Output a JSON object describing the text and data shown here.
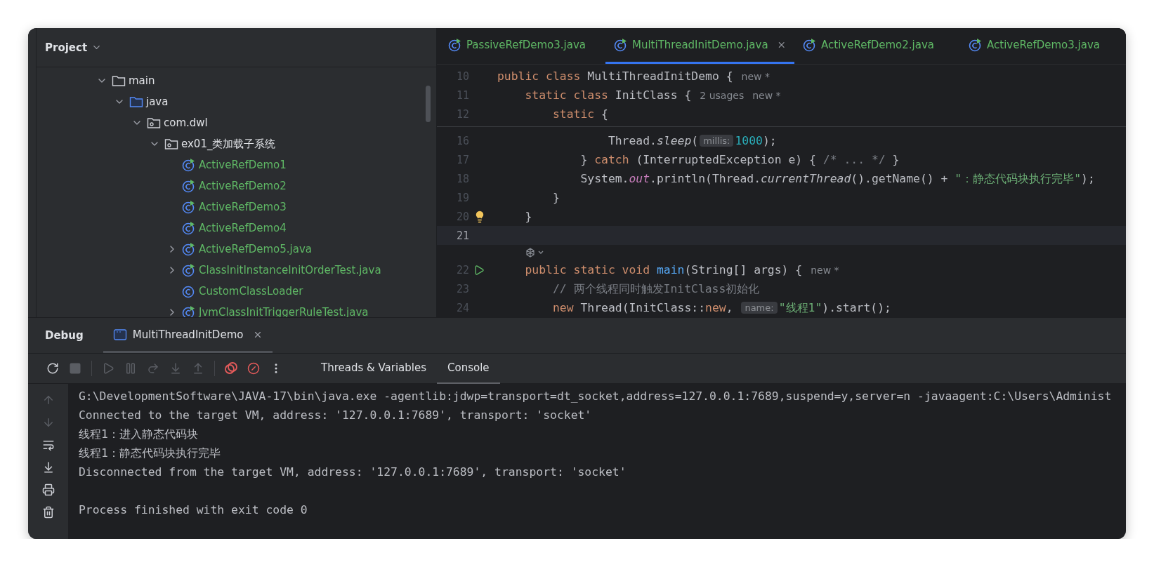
{
  "project_panel": {
    "title": "Project",
    "tree": [
      {
        "label": "main",
        "kind": "folder",
        "expanded": true,
        "children": [
          {
            "label": "java",
            "kind": "source-folder",
            "expanded": true,
            "children": [
              {
                "label": "com.dwl",
                "kind": "package",
                "expanded": true,
                "children": [
                  {
                    "label": "ex01_类加载子系统",
                    "kind": "package",
                    "expanded": true,
                    "children": [
                      {
                        "label": "ActiveRefDemo1",
                        "kind": "runnable-class"
                      },
                      {
                        "label": "ActiveRefDemo2",
                        "kind": "runnable-class"
                      },
                      {
                        "label": "ActiveRefDemo3",
                        "kind": "runnable-class"
                      },
                      {
                        "label": "ActiveRefDemo4",
                        "kind": "runnable-class"
                      },
                      {
                        "label": "ActiveRefDemo5.java",
                        "kind": "runnable-class",
                        "expanded": false
                      },
                      {
                        "label": "ClassInitInstanceInitOrderTest.java",
                        "kind": "runnable-class",
                        "expanded": false
                      },
                      {
                        "label": "CustomClassLoader",
                        "kind": "class"
                      },
                      {
                        "label": "JvmClassInitTriggerRuleTest.java",
                        "kind": "runnable-class",
                        "expanded": false
                      }
                    ]
                  }
                ]
              }
            ]
          }
        ]
      }
    ]
  },
  "editor": {
    "tabs": [
      {
        "label": "PassiveRefDemo3.java",
        "selected": false
      },
      {
        "label": "MultiThreadInitDemo.java",
        "selected": true
      },
      {
        "label": "ActiveRefDemo2.java",
        "selected": false
      },
      {
        "label": "ActiveRefDemo3.java",
        "selected": false
      }
    ],
    "sticky_lines": [
      {
        "number": "10",
        "current": false,
        "tokens": [
          {
            "kind": "kw",
            "text": "public class "
          },
          {
            "kind": "plain",
            "text": "MultiThreadInitDemo {"
          },
          {
            "kind": "annotation",
            "text": "new *"
          }
        ]
      },
      {
        "number": "11",
        "current": false,
        "tokens": [
          {
            "kind": "kw",
            "text": "    static class "
          },
          {
            "kind": "plain",
            "text": "InitClass {"
          },
          {
            "kind": "annotation",
            "text": "2 usages"
          },
          {
            "kind": "annotation",
            "text": "new *"
          }
        ]
      },
      {
        "number": "12",
        "current": false,
        "tokens": [
          {
            "kind": "kw",
            "text": "        static "
          },
          {
            "kind": "plain",
            "text": "{"
          }
        ]
      }
    ],
    "lines": [
      {
        "kind": "code",
        "number": "16",
        "current": false,
        "tokens": [
          {
            "kind": "plain",
            "text": "                Thread."
          },
          {
            "kind": "italic",
            "text": "sleep"
          },
          {
            "kind": "plain",
            "text": "("
          },
          {
            "kind": "hint",
            "text": "millis:"
          },
          {
            "kind": "num",
            "text": "1000"
          },
          {
            "kind": "plain",
            "text": ");"
          }
        ]
      },
      {
        "kind": "code",
        "number": "17",
        "current": false,
        "tokens": [
          {
            "kind": "plain",
            "text": "            } "
          },
          {
            "kind": "kw",
            "text": "catch "
          },
          {
            "kind": "plain",
            "text": "(InterruptedException e) { "
          },
          {
            "kind": "comment",
            "text": "/* ... */"
          },
          {
            "kind": "plain",
            "text": " }"
          }
        ]
      },
      {
        "kind": "code",
        "number": "18",
        "current": false,
        "tokens": [
          {
            "kind": "plain",
            "text": "            System."
          },
          {
            "kind": "field",
            "text": "out"
          },
          {
            "kind": "plain",
            "text": ".println(Thread."
          },
          {
            "kind": "italic",
            "text": "currentThread"
          },
          {
            "kind": "plain",
            "text": "().getName() + "
          },
          {
            "kind": "str",
            "text": "\"：静态代码块执行完毕\""
          },
          {
            "kind": "plain",
            "text": ");"
          }
        ]
      },
      {
        "kind": "code",
        "number": "19",
        "current": false,
        "tokens": [
          {
            "kind": "plain",
            "text": "        }"
          }
        ]
      },
      {
        "kind": "code",
        "number": "20",
        "current": false,
        "gutter_icon": {
          "kind": "bulb"
        },
        "tokens": [
          {
            "kind": "plain",
            "text": "    }"
          }
        ]
      },
      {
        "kind": "code",
        "number": "21",
        "current": true
      },
      {
        "kind": "inlay-icons"
      },
      {
        "kind": "code",
        "number": "22",
        "current": false,
        "gutter_icon": {
          "kind": "run"
        },
        "tokens": [
          {
            "kind": "kw",
            "text": "    public static void "
          },
          {
            "kind": "method",
            "text": "main"
          },
          {
            "kind": "plain",
            "text": "(String[] args) {"
          },
          {
            "kind": "annotation",
            "text": "new *"
          }
        ]
      },
      {
        "kind": "code",
        "number": "23",
        "current": false,
        "tokens": [
          {
            "kind": "comment",
            "text": "        // 两个线程同时触发InitClass初始化"
          }
        ]
      },
      {
        "kind": "code",
        "number": "24",
        "current": false,
        "tokens": [
          {
            "kind": "kw",
            "text": "        new "
          },
          {
            "kind": "plain",
            "text": "Thread(InitClass::"
          },
          {
            "kind": "kw",
            "text": "new"
          },
          {
            "kind": "plain",
            "text": ", "
          },
          {
            "kind": "hint",
            "text": "name:"
          },
          {
            "kind": "str",
            "text": "\"线程1\""
          },
          {
            "kind": "plain",
            "text": ").start();"
          }
        ]
      }
    ]
  },
  "debug_panel": {
    "title": "Debug",
    "session_tab": {
      "label": "MultiThreadInitDemo",
      "selected": true
    },
    "toolbar": [
      {
        "kind": "rerun",
        "disabled": false
      },
      {
        "kind": "stop",
        "disabled": true
      },
      {
        "kind": "separator"
      },
      {
        "kind": "resume",
        "disabled": true
      },
      {
        "kind": "pause",
        "disabled": true
      },
      {
        "kind": "step-over",
        "disabled": true
      },
      {
        "kind": "step-into",
        "disabled": true
      },
      {
        "kind": "step-out",
        "disabled": true
      },
      {
        "kind": "separator"
      },
      {
        "kind": "breakpoints",
        "disabled": false
      },
      {
        "kind": "mute",
        "disabled": false
      },
      {
        "kind": "more",
        "disabled": false
      }
    ],
    "tabs": [
      {
        "label": "Threads & Variables",
        "selected": false
      },
      {
        "label": "Console",
        "selected": true
      }
    ],
    "side_tools": [
      {
        "kind": "up",
        "disabled": true
      },
      {
        "kind": "down",
        "disabled": true
      },
      {
        "kind": "wrap",
        "disabled": false
      },
      {
        "kind": "scroll-end",
        "disabled": false
      },
      {
        "kind": "print",
        "disabled": false
      },
      {
        "kind": "trash",
        "disabled": false
      }
    ],
    "console": [
      {
        "kind": "text",
        "text": "G:\\DevelopmentSoftware\\JAVA-17\\bin\\java.exe -agentlib:jdwp=transport=dt_socket,address=127.0.0.1:7689,suspend=y,server=n -javaagent:C:\\Users\\Administ"
      },
      {
        "kind": "text",
        "text": "Connected to the target VM, address: '127.0.0.1:7689', transport: 'socket'"
      },
      {
        "kind": "text",
        "text": "线程1：进入静态代码块"
      },
      {
        "kind": "text",
        "text": "线程1：静态代码块执行完毕"
      },
      {
        "kind": "text",
        "text": "Disconnected from the target VM, address: '127.0.0.1:7689', transport: 'socket'"
      },
      {
        "kind": "blank"
      },
      {
        "kind": "text",
        "text": "Process finished with exit code 0"
      }
    ]
  }
}
